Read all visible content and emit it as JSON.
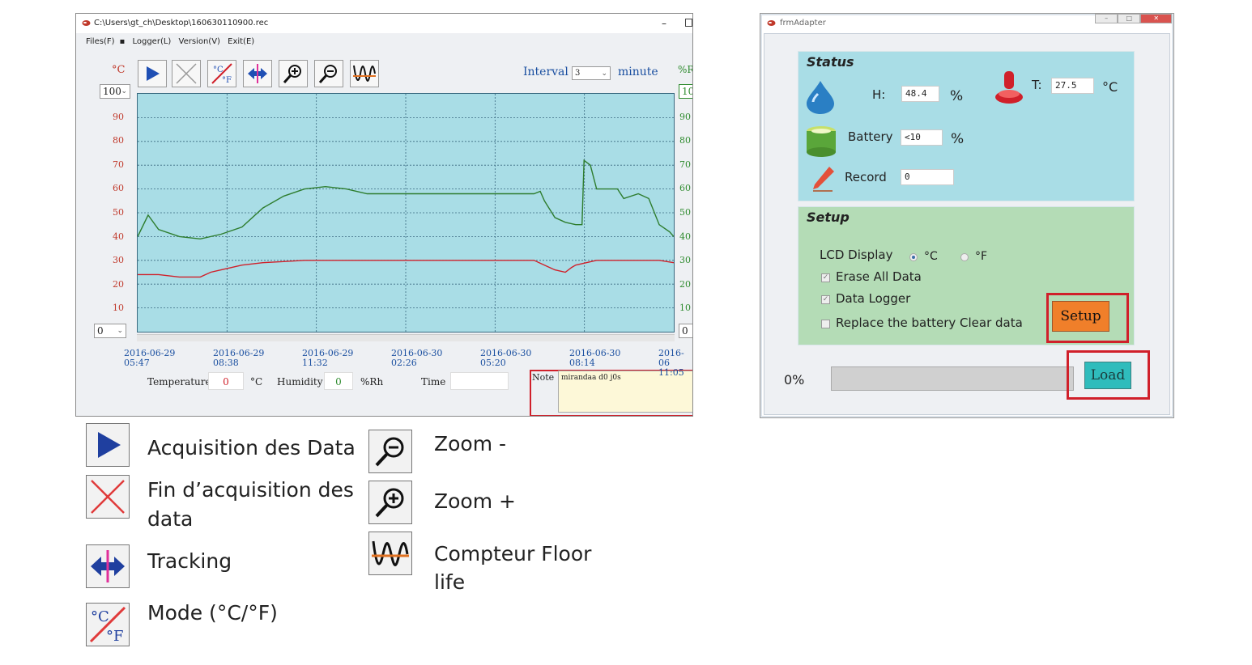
{
  "logger_window": {
    "title": "C:\\Users\\gt_ch\\Desktop\\160630110900.rec",
    "menu": [
      "Files(F)",
      "Logger(L)",
      "Version(V)",
      "Exit(E)"
    ],
    "unit_left": "°C",
    "unit_right": "%R",
    "ymax_left": "100",
    "ymin_left": "0",
    "ymax_right": "100",
    "ymin_right": "0",
    "interval_label": "Interval",
    "interval_value": "3",
    "minute_label": "minute",
    "toolbar_icons": [
      "play-icon",
      "stop-icon",
      "unit-toggle-icon",
      "tracking-icon",
      "zoom-in-icon",
      "zoom-out-icon",
      "floor-life-icon"
    ],
    "temperature_label": "Temperature",
    "temperature_value": "0",
    "temperature_unit": "°C",
    "humidity_label": "Humidity",
    "humidity_value": "0",
    "humidity_unit": "%Rh",
    "time_label": "Time",
    "time_value": "",
    "note_label": "Note",
    "note_value": "mirandaa d0 j0s"
  },
  "chart_data": {
    "type": "line",
    "yticks": [
      "90",
      "80",
      "70",
      "60",
      "50",
      "40",
      "30",
      "20",
      "10"
    ],
    "ylim": [
      0,
      100
    ],
    "x_ticks": [
      {
        "date": "2016-06-29",
        "time": "05:47"
      },
      {
        "date": "2016-06-29",
        "time": "08:38"
      },
      {
        "date": "2016-06-29",
        "time": "11:32"
      },
      {
        "date": "2016-06-30",
        "time": "02:26"
      },
      {
        "date": "2016-06-30",
        "time": "05:20"
      },
      {
        "date": "2016-06-30",
        "time": "08:14"
      },
      {
        "date": "2016-06",
        "time": "11:05"
      }
    ],
    "grid": true,
    "series": [
      {
        "color": "#2e7d2e",
        "points": [
          [
            0,
            40
          ],
          [
            0.5,
            49
          ],
          [
            1,
            43
          ],
          [
            2,
            40
          ],
          [
            3,
            39
          ],
          [
            4,
            41
          ],
          [
            5,
            44
          ],
          [
            6,
            52
          ],
          [
            7,
            57
          ],
          [
            8,
            60
          ],
          [
            9,
            61
          ],
          [
            10,
            60
          ],
          [
            11,
            58
          ],
          [
            12,
            58
          ],
          [
            13,
            58
          ],
          [
            14,
            58
          ],
          [
            15,
            58
          ],
          [
            16,
            58
          ],
          [
            17,
            58
          ],
          [
            18,
            58
          ],
          [
            19,
            58
          ],
          [
            19.3,
            59
          ],
          [
            19.5,
            55
          ],
          [
            20,
            48
          ],
          [
            20.5,
            46
          ],
          [
            21,
            45
          ],
          [
            21.3,
            45
          ],
          [
            21.4,
            72
          ],
          [
            21.7,
            70
          ],
          [
            22,
            60
          ],
          [
            23,
            60
          ],
          [
            23.3,
            56
          ],
          [
            24,
            58
          ],
          [
            24.5,
            56
          ],
          [
            25,
            45
          ],
          [
            25.5,
            42
          ],
          [
            25.7,
            40
          ]
        ]
      },
      {
        "color": "#d0202a",
        "points": [
          [
            0,
            24
          ],
          [
            1,
            24
          ],
          [
            2,
            23
          ],
          [
            3,
            23
          ],
          [
            3.5,
            25
          ],
          [
            4,
            26
          ],
          [
            5,
            28
          ],
          [
            6,
            29
          ],
          [
            7,
            29.5
          ],
          [
            8,
            30
          ],
          [
            9,
            30
          ],
          [
            10,
            30
          ],
          [
            11,
            30
          ],
          [
            12,
            30
          ],
          [
            13,
            30
          ],
          [
            14,
            30
          ],
          [
            15,
            30
          ],
          [
            16,
            30
          ],
          [
            17,
            30
          ],
          [
            18,
            30
          ],
          [
            19,
            30
          ],
          [
            19.5,
            28
          ],
          [
            20,
            26
          ],
          [
            20.5,
            25
          ],
          [
            20.8,
            27
          ],
          [
            21,
            28
          ],
          [
            22,
            30
          ],
          [
            23,
            30
          ],
          [
            24,
            30
          ],
          [
            25,
            30
          ],
          [
            25.7,
            29
          ]
        ]
      }
    ],
    "xlim": [
      0,
      25.7
    ]
  },
  "adapter_window": {
    "title": "frmAdapter",
    "status_title": "Status",
    "h_label": "H:",
    "h_value": "48.4",
    "h_unit": "%",
    "t_label": "T:",
    "t_value": "27.5",
    "t_unit": "°C",
    "battery_label": "Battery",
    "battery_value": "<10",
    "battery_unit": "%",
    "record_label": "Record",
    "record_value": "0",
    "setup_title": "Setup",
    "lcd_label": "LCD Display",
    "lcd_c": "°C",
    "lcd_f": "°F",
    "erase_label": "Erase All Data",
    "datalogger_label": "Data Logger",
    "replace_label": "Replace the battery Clear data",
    "setup_button": "Setup",
    "load_button": "Load",
    "progress_label": "0%",
    "progress": 0
  },
  "legend": {
    "acquisition": "Acquisition  des Data",
    "fin_line1": "Fin d’acquisition des",
    "fin_line2": "data",
    "tracking": "Tracking",
    "mode": "Mode (°C/°F)",
    "zoom_minus": "Zoom -",
    "zoom_plus": "Zoom +",
    "compteur_line1": "Compteur Floor",
    "compteur_line2": "life"
  }
}
